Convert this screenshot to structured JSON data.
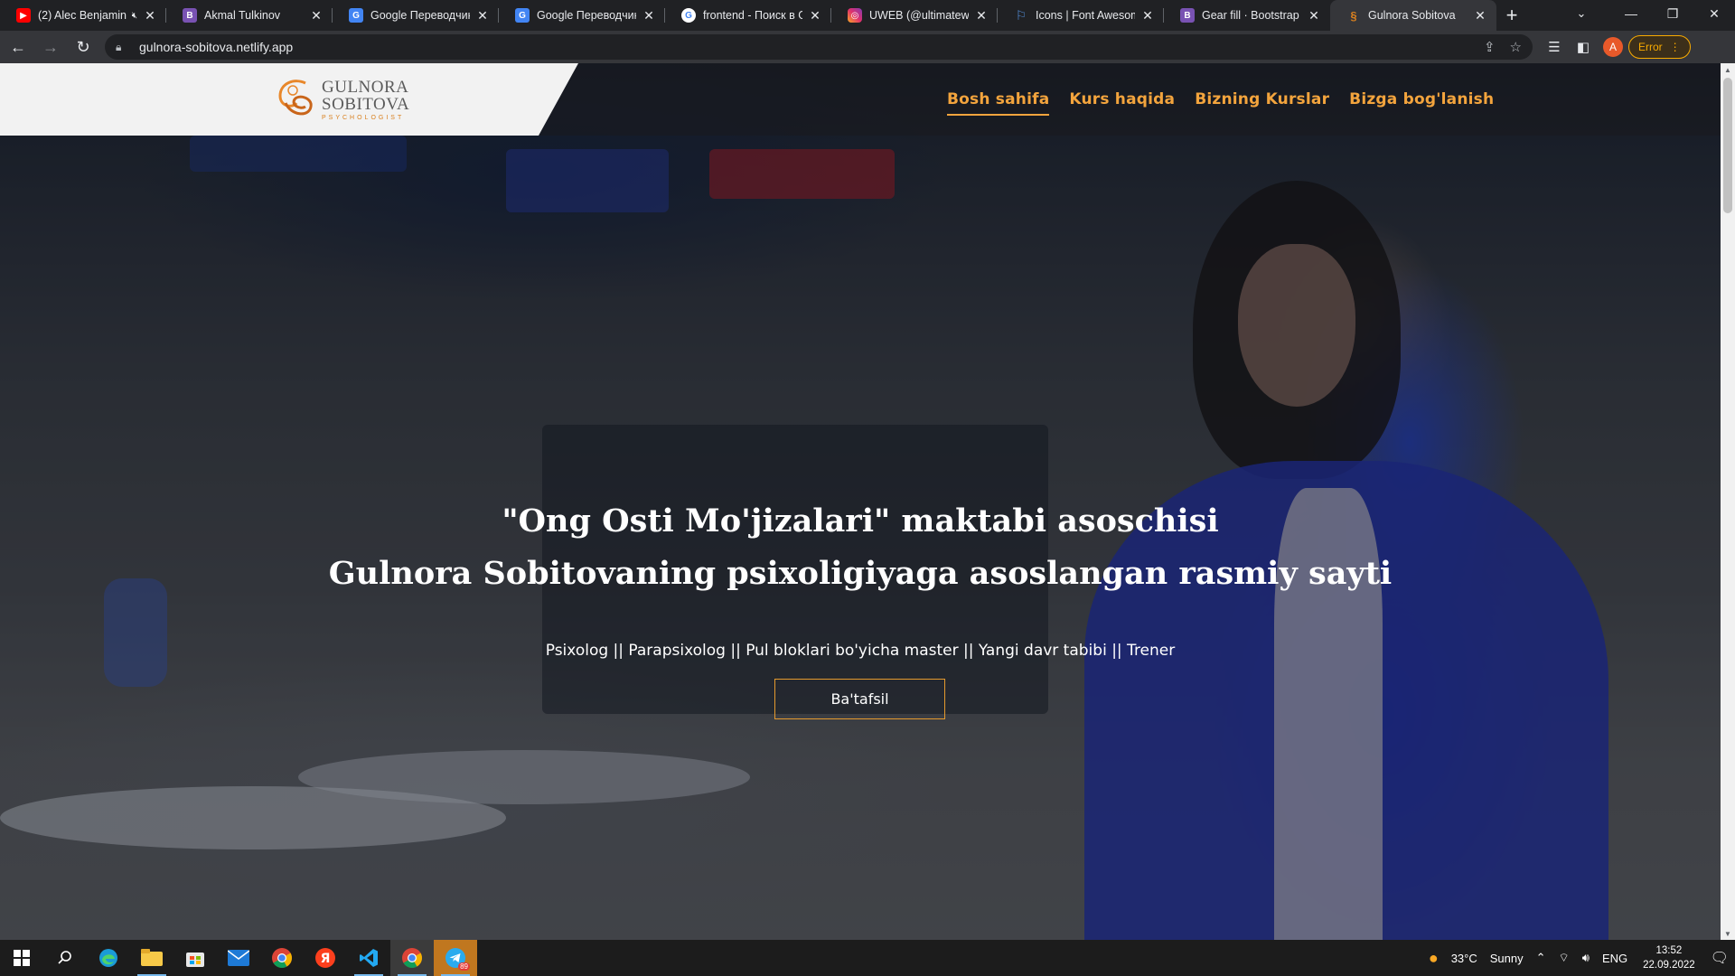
{
  "browser": {
    "tabs": [
      {
        "title": "(2) Alec Benjamin",
        "favicon": "youtube-icon",
        "color": "#ff0000",
        "muted": true
      },
      {
        "title": "Akmal Tulkinov",
        "favicon": "bootstrap-icon",
        "color": "#7952b3"
      },
      {
        "title": "Google Переводчик",
        "favicon": "google-translate-icon",
        "color": "#4285f4"
      },
      {
        "title": "Google Переводчик",
        "favicon": "google-translate-icon",
        "color": "#4285f4"
      },
      {
        "title": "frontend - Поиск в Go",
        "favicon": "google-icon",
        "color": "#ffffff"
      },
      {
        "title": "UWEB (@ultimateweb",
        "favicon": "instagram-icon",
        "color": "#e1306c"
      },
      {
        "title": "Icons | Font Awesome",
        "favicon": "font-awesome-flag-icon",
        "color": "#528dd7"
      },
      {
        "title": "Gear fill · Bootstrap Ic",
        "favicon": "bootstrap-icon",
        "color": "#7952b3"
      },
      {
        "title": "Gulnora Sobitova",
        "favicon": "site-logo-icon",
        "color": "#d9801f",
        "active": true
      }
    ],
    "url": "gulnora-sobitova.netlify.app",
    "profile_initial": "A",
    "error_label": "Error"
  },
  "site": {
    "logo": {
      "line1": "GULNORA",
      "line2": "SOBITOVA",
      "tagline": "PSYCHOLOGIST"
    },
    "menu": [
      "Bosh sahifa",
      "Kurs haqida",
      "Bizning Kurslar",
      "Bizga bog'lanish"
    ],
    "hero": {
      "title_line1": "\"Ong Osti Mo'jizalari\" maktabi asoschisi",
      "title_line2": "Gulnora Sobitovaning psixoligiyaga asoslangan rasmiy sayti",
      "subtitle": "Psixolog || Parapsixolog || Pul bloklari bo'yicha master || Yangi davr tabibi || Trener",
      "button": "Ba'tafsil"
    },
    "accent_color": "#f3a43d"
  },
  "taskbar": {
    "weather": {
      "temp": "33°C",
      "condition": "Sunny"
    },
    "language": "ENG",
    "time": "13:52",
    "date": "22.09.2022",
    "telegram_badge": "89"
  }
}
